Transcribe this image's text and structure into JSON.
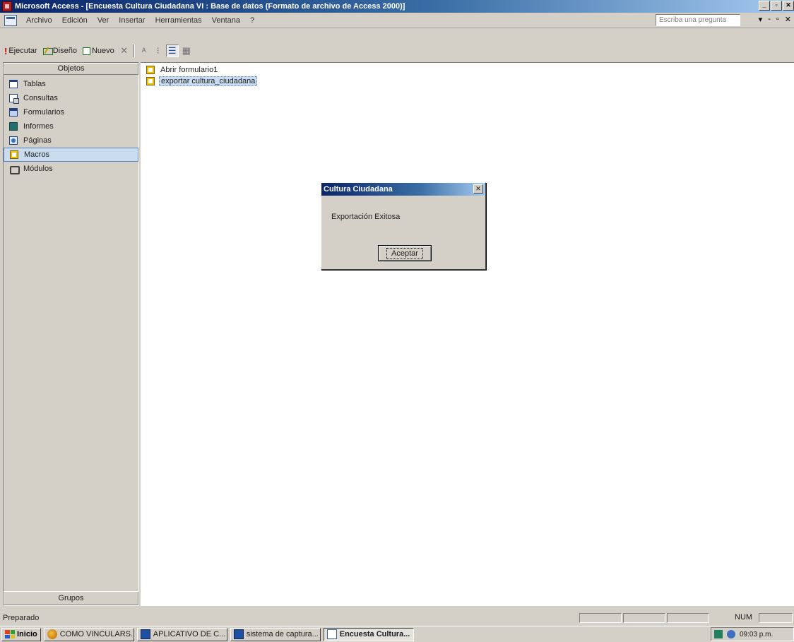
{
  "window": {
    "title": "Microsoft Access - [Encuesta Cultura Ciudadana VI : Base de datos (Formato de archivo de Access 2000)]",
    "buttons": {
      "minimize": "_",
      "restore": "▫",
      "close": "✕"
    }
  },
  "menubar": {
    "items": [
      "Archivo",
      "Edición",
      "Ver",
      "Insertar",
      "Herramientas",
      "Ventana",
      "?"
    ],
    "ask_placeholder": "Escriba una pregunta",
    "right_controls": [
      "▾",
      "-",
      "▫",
      "✕"
    ]
  },
  "db_toolbar": {
    "run": "Ejecutar",
    "design": "Diseño",
    "new": "Nuevo",
    "delete_icon": "✕",
    "icons": [
      "large-icons-icon",
      "small-icons-icon",
      "list-view-icon",
      "details-view-icon"
    ]
  },
  "objects_panel": {
    "header": "Objetos",
    "items": [
      {
        "label": "Tablas",
        "icon": "table-icon"
      },
      {
        "label": "Consultas",
        "icon": "query-icon"
      },
      {
        "label": "Formularios",
        "icon": "form-icon"
      },
      {
        "label": "Informes",
        "icon": "report-icon"
      },
      {
        "label": "Páginas",
        "icon": "page-icon"
      },
      {
        "label": "Macros",
        "icon": "macro-icon",
        "selected": true
      },
      {
        "label": "Módulos",
        "icon": "module-icon"
      }
    ],
    "groups": "Grupos"
  },
  "macro_list": [
    {
      "label": "Abrir formulario1"
    },
    {
      "label": "exportar cultura_ciudadana",
      "selected": true
    }
  ],
  "dialog": {
    "title": "Cultura Ciudadana",
    "message": "Exportación Exitosa",
    "ok": "Aceptar"
  },
  "statusbar": {
    "text": "Preparado",
    "num": "NUM"
  },
  "taskbar": {
    "start": "Inicio",
    "tasks": [
      {
        "label": "COMO VINCULARS...",
        "icon": "browser-icon"
      },
      {
        "label": "APLICATIVO DE C...",
        "icon": "word-icon"
      },
      {
        "label": "sistema de captura...",
        "icon": "word-icon"
      },
      {
        "label": "Encuesta Cultura...",
        "icon": "access-icon",
        "active": true
      }
    ],
    "clock": "09:03 p.m."
  }
}
